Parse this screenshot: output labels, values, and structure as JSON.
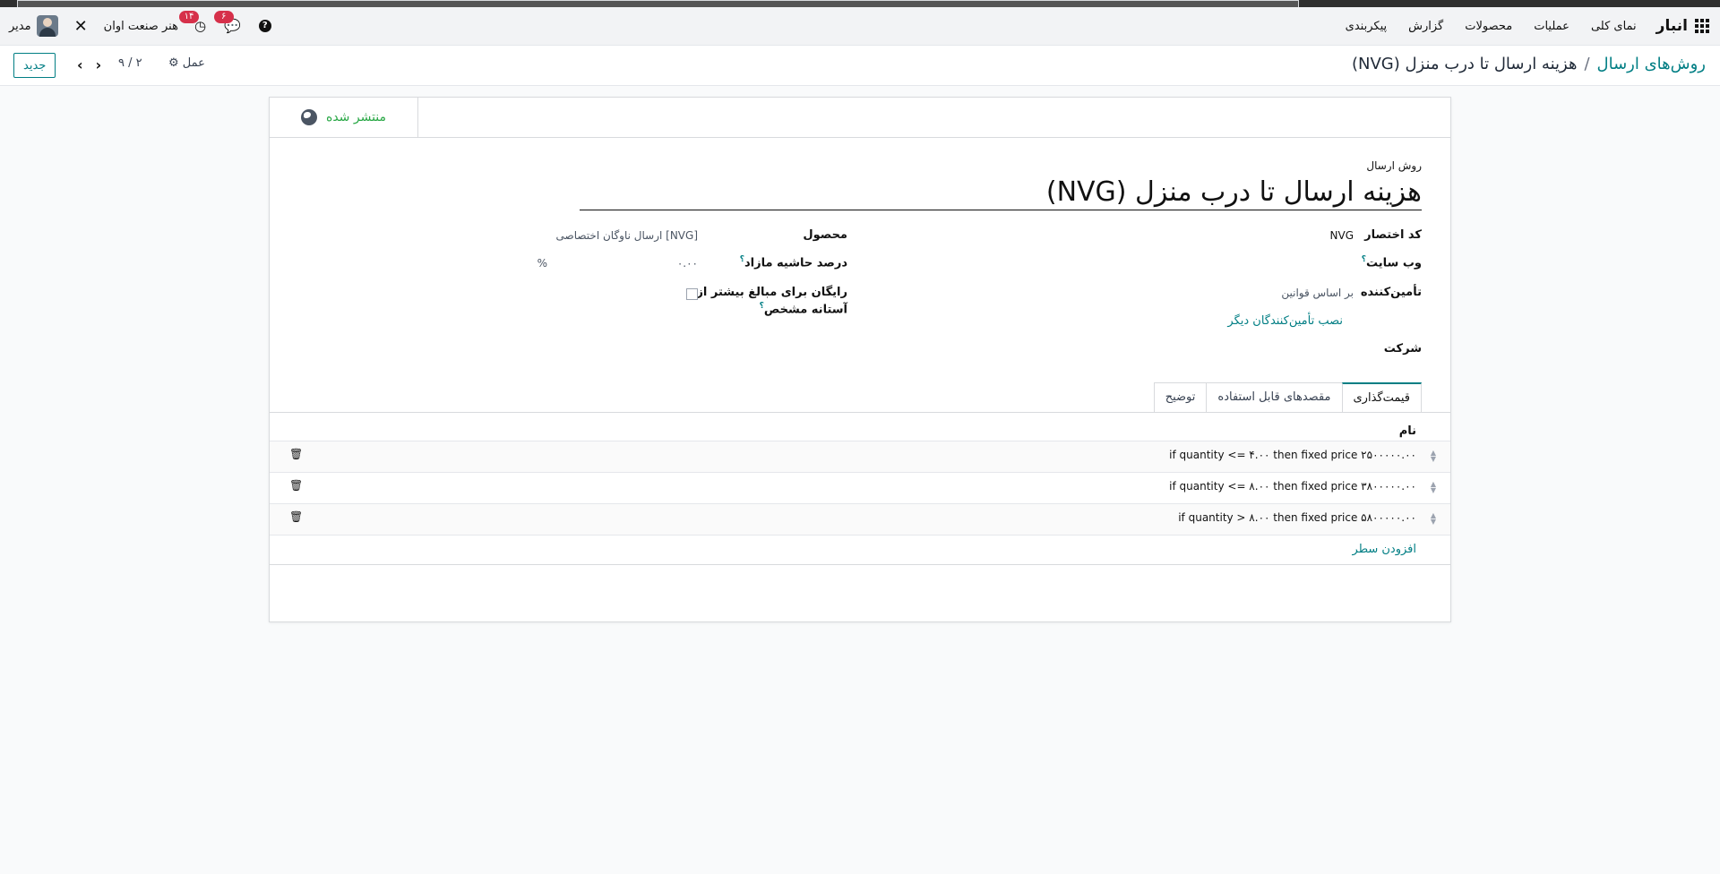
{
  "navbar": {
    "brand": "انبار",
    "menu": [
      "نمای کلی",
      "عملیات",
      "محصولات",
      "گزارش",
      "پیکربندی"
    ],
    "user_name": "مدیر",
    "company": "هنر صنعت اوان",
    "activity_count": "۱۴",
    "messages_count": "۶"
  },
  "breadcrumb": {
    "parent": "روش‌های ارسال",
    "separator": "/",
    "current": "هزینه ارسال تا درب منزل (NVG)"
  },
  "controls": {
    "new_button": "جدید",
    "pager": "۹ / ۲",
    "action": "عمل"
  },
  "buttonbox": {
    "published": "منتشر شده"
  },
  "form": {
    "label": "روش ارسال",
    "name": "هزینه ارسال تا درب منزل (NVG)",
    "fields": {
      "code_label": "کد اختصار",
      "code_value": "NVG",
      "website_label": "وب سایت",
      "provider_label": "تأمین‌کننده",
      "provider_value": "بر اساس قوانین",
      "install_providers": "نصب تأمین‌کنندگان دیگر",
      "company_label": "شرکت",
      "product_label": "محصول",
      "product_value": "[NVG] ارسال ناوگان اختصاصی",
      "margin_label": "درصد حاشیه مازاد",
      "margin_value": "۰.۰۰",
      "margin_unit": "%",
      "free_label_1": "رایگان برای مبالغ بیشتر از",
      "free_label_2": "آستانه مشخص",
      "help_mark": "؟"
    }
  },
  "tabs": [
    "قیمت‌گذاری",
    "مقصدهای قابل استفاده",
    "توضیح"
  ],
  "pricing": {
    "column_name": "نام",
    "rows": [
      "if quantity <= ۴.۰۰ then fixed price ۲۵۰۰۰۰۰.۰۰",
      "if quantity <= ۸.۰۰ then fixed price ۳۸۰۰۰۰۰.۰۰",
      "if quantity > ۸.۰۰ then fixed price ۵۸۰۰۰۰۰.۰۰"
    ],
    "add_line": "افزودن سطر"
  },
  "colors": {
    "accent": "#017e84",
    "published": "#28a745",
    "badge": "#d6304a"
  }
}
